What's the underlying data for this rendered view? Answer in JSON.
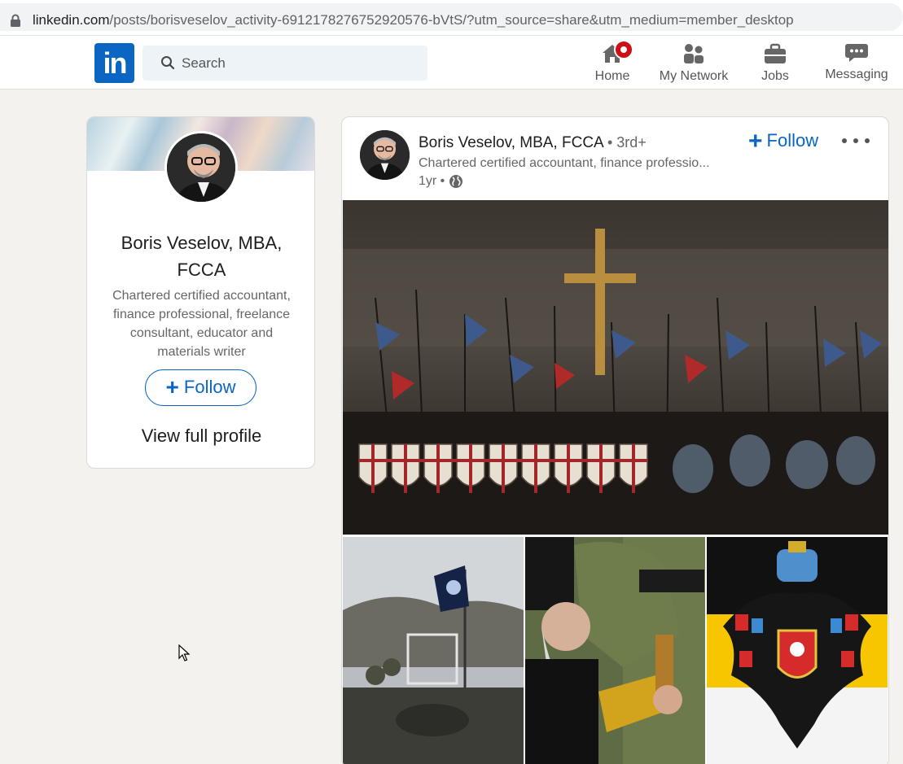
{
  "browser": {
    "url_host": "linkedin.com",
    "url_path": "/posts/borisveselov_activity-6912178276752920576-bVtS/?utm_source=share&utm_medium=member_desktop"
  },
  "nav": {
    "logo_text": "in",
    "search_placeholder": "Search",
    "items": [
      {
        "label": "Home",
        "icon": "home-icon",
        "notification": true
      },
      {
        "label": "My Network",
        "icon": "people-icon"
      },
      {
        "label": "Jobs",
        "icon": "briefcase-icon"
      },
      {
        "label": "Messaging",
        "icon": "chat-icon"
      }
    ]
  },
  "profile": {
    "name": "Boris Veselov, MBA, FCCA",
    "headline": "Chartered certified accountant, finance professional, freelance consultant, educator and materials writer",
    "follow_label": "Follow",
    "view_profile_label": "View full profile"
  },
  "post": {
    "author": "Boris Veselov, MBA, FCCA",
    "degree": "• 3rd+",
    "subtitle": "Chartered certified accountant, finance professio...",
    "time": "1yr •",
    "follow_label": "Follow",
    "images": [
      {
        "name": "crusader-army-image"
      },
      {
        "name": "armored-vehicle-soldiers-image"
      },
      {
        "name": "priest-soldiers-image"
      },
      {
        "name": "imperial-eagle-flag-image"
      }
    ]
  },
  "colors": {
    "brand": "#0a66c2",
    "badge": "#cc1016",
    "page_bg": "#f3f2ef"
  }
}
